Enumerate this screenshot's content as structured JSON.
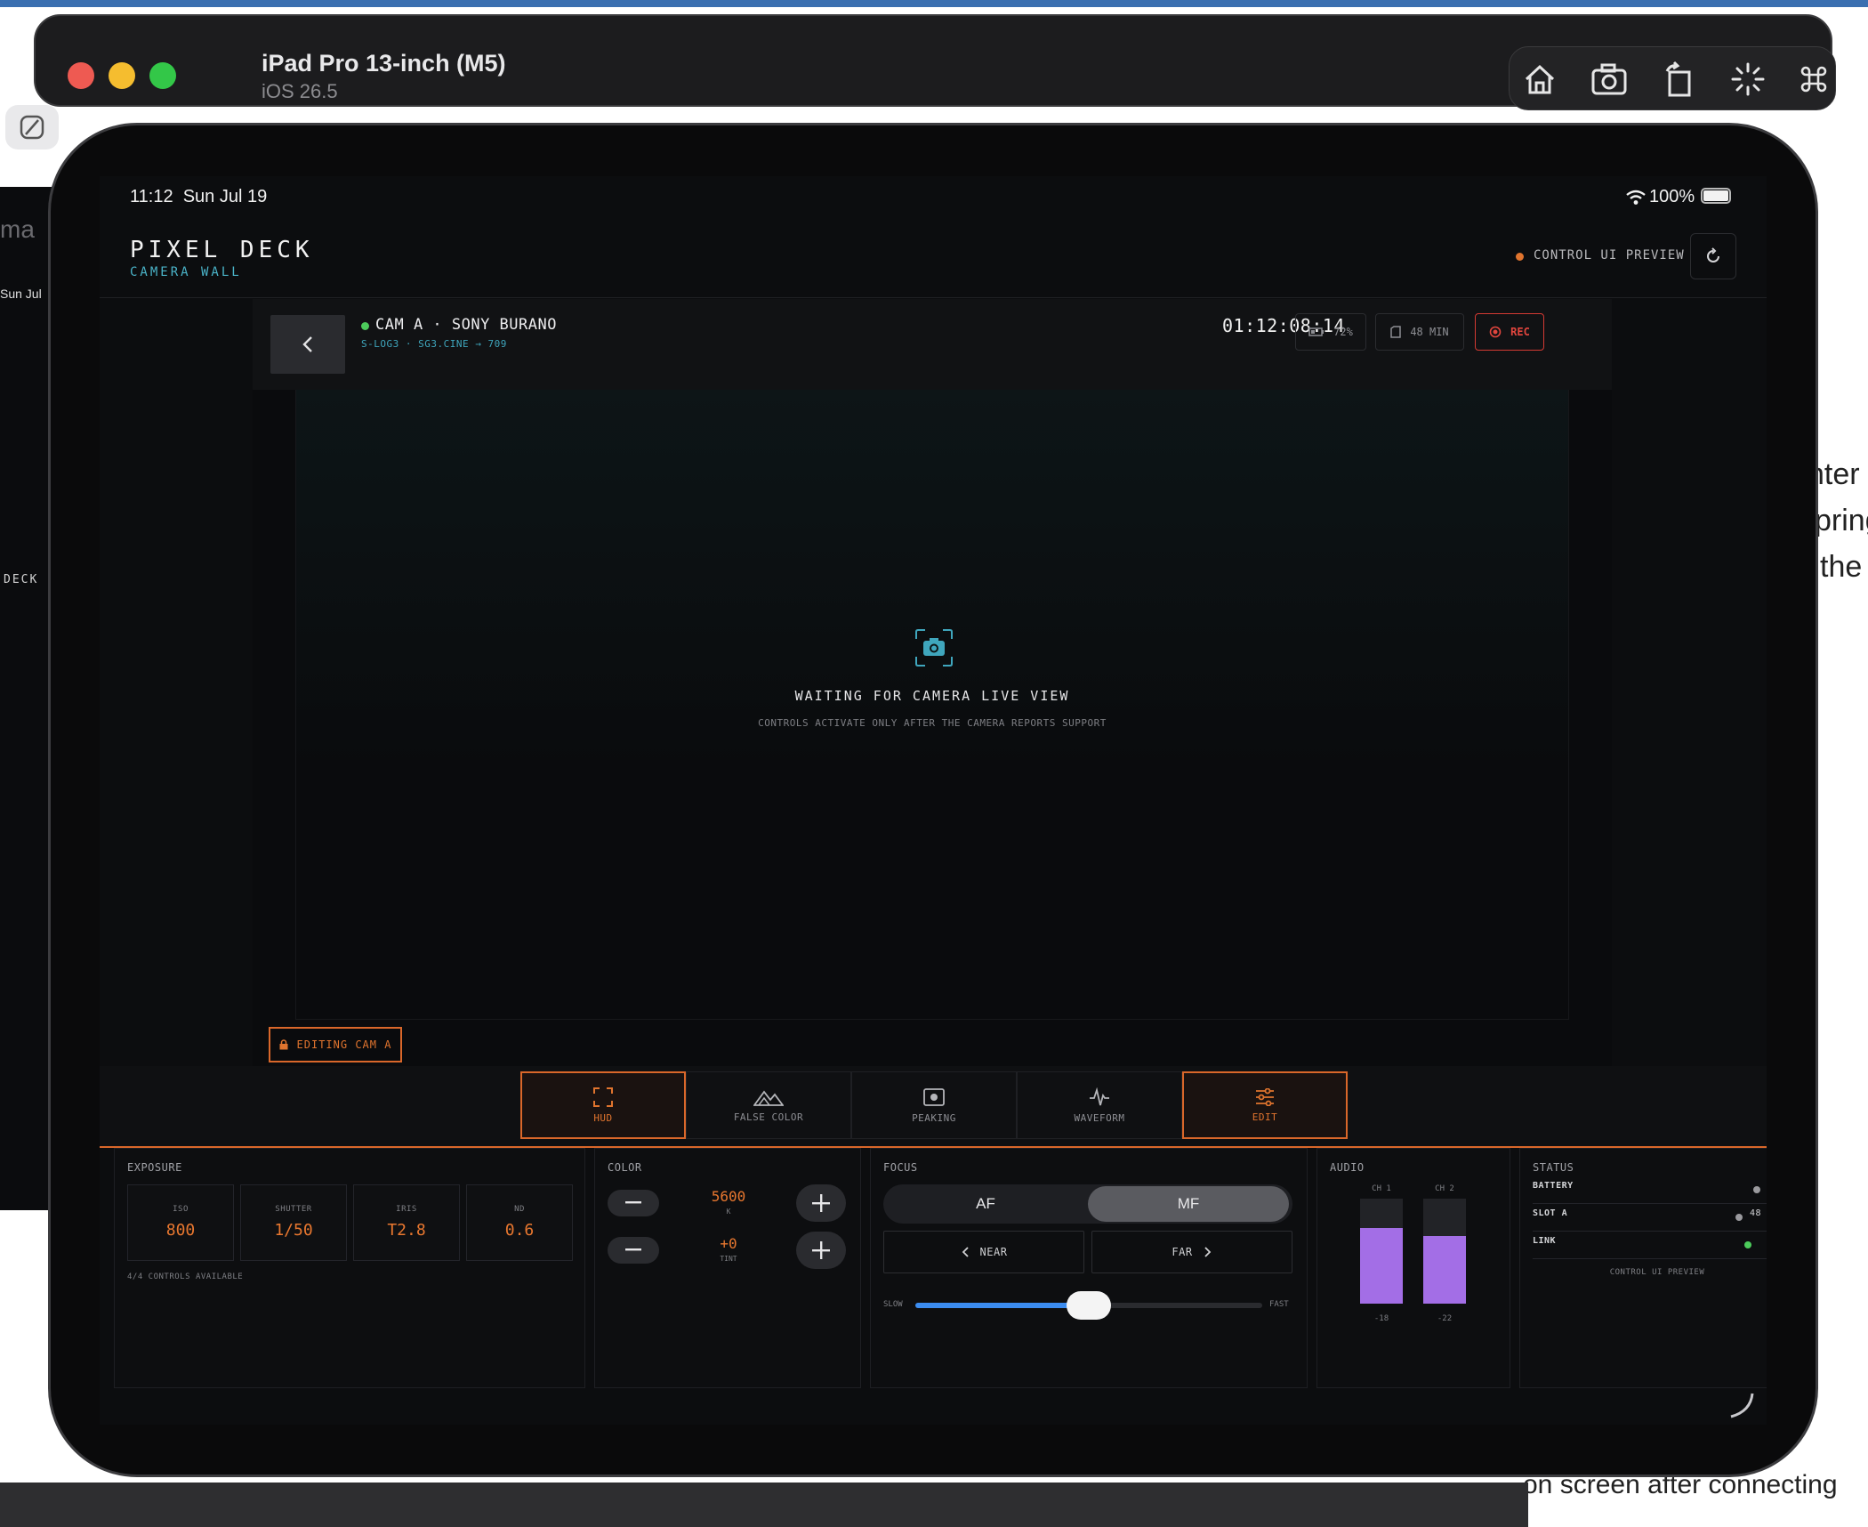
{
  "simulator": {
    "device_name": "iPad Pro 13-inch (M5)",
    "os_version": "iOS 26.5",
    "tools": [
      "home-icon",
      "screenshot-icon",
      "rotate-icon",
      "shake-icon",
      "keyboard-command-icon"
    ]
  },
  "background": {
    "left_fragments": [
      "ma",
      "Sun Jul",
      "DECK"
    ],
    "right_fragments": [
      "nter",
      "pring",
      "the"
    ],
    "bottom_fragment": "on screen after connecting"
  },
  "status_bar": {
    "time": "11:12",
    "date": "Sun Jul 19",
    "battery": "100%"
  },
  "app": {
    "title": "PIXEL DECK",
    "subtitle": "CAMERA WALL",
    "preview_label": "CONTROL UI PREVIEW",
    "accent": "#e0742e"
  },
  "camera": {
    "name": "CAM A · SONY BURANO",
    "profile": "S-LOG3 · SG3.CINE → 709",
    "timecode": "01:12:08:14",
    "battery": "72%",
    "media_remaining": "48 MIN",
    "rec_label": "REC",
    "status_color": "#4ccb5b"
  },
  "live_view": {
    "title": "WAITING FOR CAMERA LIVE VIEW",
    "subtitle": "CONTROLS ACTIVATE ONLY AFTER THE CAMERA REPORTS SUPPORT",
    "editing_badge": "EDITING CAM A"
  },
  "tools": [
    {
      "label": "HUD",
      "icon": "focus-frame-icon",
      "active": true
    },
    {
      "label": "FALSE COLOR",
      "icon": "mountains-icon",
      "active": false
    },
    {
      "label": "PEAKING",
      "icon": "peaking-icon",
      "active": false
    },
    {
      "label": "WAVEFORM",
      "icon": "waveform-icon",
      "active": false
    },
    {
      "label": "EDIT",
      "icon": "sliders-icon",
      "active": true
    }
  ],
  "exposure": {
    "title": "EXPOSURE",
    "controls": [
      {
        "label": "ISO",
        "value": "800"
      },
      {
        "label": "SHUTTER",
        "value": "1/50"
      },
      {
        "label": "IRIS",
        "value": "T2.8"
      },
      {
        "label": "ND",
        "value": "0.6"
      }
    ],
    "footnote": "4/4 CONTROLS AVAILABLE"
  },
  "color": {
    "title": "COLOR",
    "kelvin_value": "5600",
    "kelvin_unit": "K",
    "tint_value": "+0",
    "tint_label": "TINT"
  },
  "focus": {
    "title": "FOCUS",
    "af_label": "AF",
    "mf_label": "MF",
    "mode": "MF",
    "near_label": "NEAR",
    "far_label": "FAR",
    "slow_label": "SLOW",
    "fast_label": "FAST",
    "speed_fraction": 0.5
  },
  "audio": {
    "title": "AUDIO",
    "channels": [
      {
        "label": "CH 1",
        "level": "-18",
        "fill": 0.72
      },
      {
        "label": "CH 2",
        "level": "-22",
        "fill": 0.64
      }
    ]
  },
  "status_panel": {
    "title": "STATUS",
    "rows": [
      {
        "label": "BATTERY",
        "value": "",
        "dot_color": "#9a9a9e"
      },
      {
        "label": "SLOT A",
        "value": "48",
        "dot_color": "#9a9a9e"
      },
      {
        "label": "LINK",
        "value": "",
        "dot_color": "#4ccb5b"
      }
    ],
    "footer": "CONTROL UI PREVIEW"
  }
}
